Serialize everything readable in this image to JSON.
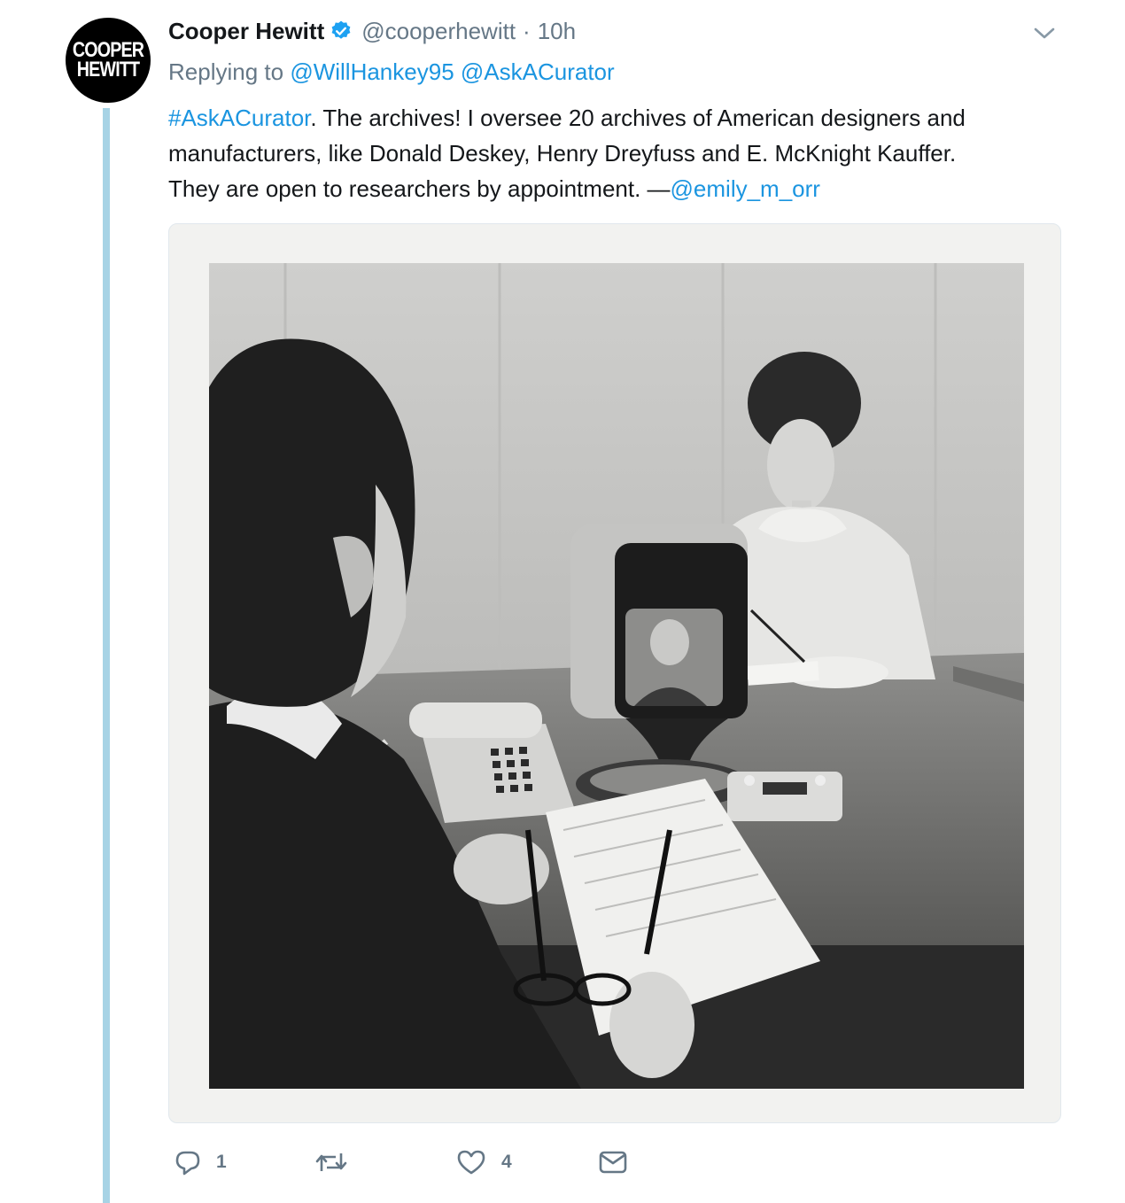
{
  "tweet": {
    "avatar": {
      "line1": "COOPER",
      "line2": "HEWITT",
      "color": "#000000"
    },
    "author": {
      "display_name": "Cooper Hewitt",
      "handle": "@cooperhewitt",
      "separator": "·",
      "timestamp": "10h",
      "verified_icon": "verified-badge-icon"
    },
    "replying": {
      "prefix": "Replying to",
      "mentions": [
        "@WillHankey95",
        "@AskACurator"
      ]
    },
    "text": {
      "hashtag": "#AskACurator",
      "line1_rest": ". The archives! I oversee 20 archives of American designers and",
      "line2": "manufacturers, like Donald Deskey, Henry Dreyfuss and E. McKnight Kauffer.",
      "line3_text": "They are open to researchers by appointment. —",
      "line3_mention": "@emily_m_orr"
    },
    "actions": {
      "reply_count": "1",
      "retweet_count": "",
      "like_count": "4",
      "icons": [
        "reply-icon",
        "retweet-icon",
        "like-icon",
        "direct-message-icon"
      ]
    },
    "colors": {
      "link": "#1b95e0",
      "secondary_text": "#657786",
      "thread_line": "#a7d3e5",
      "verified": "#1da1f2"
    }
  }
}
